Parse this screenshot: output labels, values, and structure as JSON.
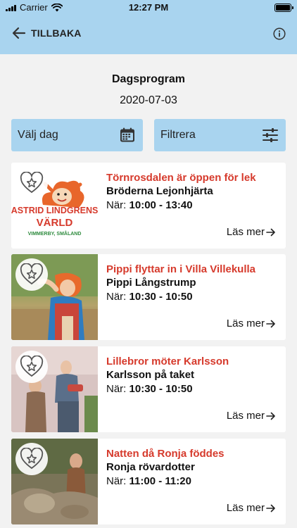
{
  "status_bar": {
    "carrier": "Carrier",
    "time": "12:27 PM",
    "battery_level": 1.0
  },
  "nav": {
    "back_label": "TILLBAKA",
    "back_icon": "arrow-left-icon",
    "info_icon": "info-circle-icon"
  },
  "header": {
    "title": "Dagsprogram",
    "date": "2020-07-03"
  },
  "controls": {
    "day_label": "Välj dag",
    "day_icon": "calendar-icon",
    "filter_label": "Filtrera",
    "filter_icon": "sliders-icon"
  },
  "events": [
    {
      "title": "Törnrosdalen är öppen för lek",
      "subtitle": "Bröderna Lejonhjärta",
      "time_prefix": "När:",
      "time": "10:00 - 13:40",
      "more_label": "Läs mer",
      "image": "astrid-lindgrens-varld-logo",
      "logo_line1": "ASTRID LINDGRENS",
      "logo_line2": "VÄRLD",
      "logo_line3": "VIMMERBY, SMÅLAND"
    },
    {
      "title": "Pippi flyttar in i Villa Villekulla",
      "subtitle": "Pippi Långstrump",
      "time_prefix": "När:",
      "time": "10:30 - 10:50",
      "more_label": "Läs mer",
      "image": "pippi-photo"
    },
    {
      "title": "Lillebror möter Karlsson",
      "subtitle": "Karlsson på taket",
      "time_prefix": "När:",
      "time": "10:30 - 10:50",
      "more_label": "Läs mer",
      "image": "karlsson-photo"
    },
    {
      "title": "Natten då Ronja föddes",
      "subtitle": "Ronja rövardotter",
      "time_prefix": "När:",
      "time": "11:00 - 11:20",
      "more_label": "Läs mer",
      "image": "ronja-photo"
    }
  ],
  "colors": {
    "nav_bg": "#a9d4ef",
    "title_red": "#d63a2c",
    "page_bg": "#f2f2f2"
  }
}
